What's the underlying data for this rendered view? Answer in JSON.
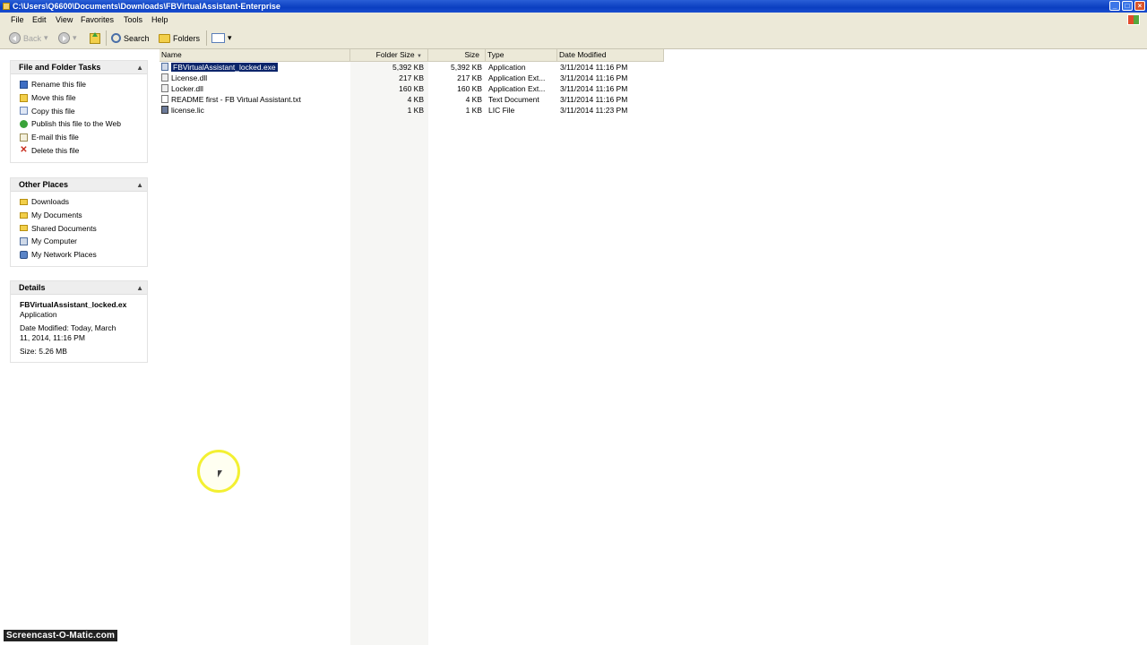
{
  "window": {
    "title": "C:\\Users\\Q6600\\Documents\\Downloads\\FBVirtualAssistant-Enterprise",
    "minimize": "_",
    "maximize": "□",
    "close": "×"
  },
  "menu": [
    "File",
    "Edit",
    "View",
    "Favorites",
    "Tools",
    "Help"
  ],
  "toolbar": {
    "back": "Back",
    "search": "Search",
    "folders": "Folders"
  },
  "tasks_panel": {
    "title": "File and Folder Tasks",
    "collapse": "▲",
    "items": [
      {
        "label": "Rename this file",
        "icon": "rename-icon"
      },
      {
        "label": "Move this file",
        "icon": "move-icon"
      },
      {
        "label": "Copy this file",
        "icon": "copy-icon"
      },
      {
        "label": "Publish this file to the Web",
        "icon": "web-icon"
      },
      {
        "label": "E-mail this file",
        "icon": "email-icon"
      },
      {
        "label": "Delete this file",
        "icon": "delete-icon"
      }
    ]
  },
  "places_panel": {
    "title": "Other Places",
    "collapse": "▲",
    "items": [
      {
        "label": "Downloads",
        "icon": "folder-icon"
      },
      {
        "label": "My Documents",
        "icon": "my-documents-icon"
      },
      {
        "label": "Shared Documents",
        "icon": "shared-documents-icon"
      },
      {
        "label": "My Computer",
        "icon": "computer-icon"
      },
      {
        "label": "My Network Places",
        "icon": "network-icon"
      }
    ]
  },
  "details_panel": {
    "title": "Details",
    "collapse": "▲",
    "name": "FBVirtualAssistant_locked.ex",
    "type": "Application",
    "modified_line1": "Date Modified: Today, March",
    "modified_line2": "11, 2014, 11:16 PM",
    "size": "Size: 5.26 MB"
  },
  "columns": {
    "name": "Name",
    "folder_size": "Folder Size",
    "size": "Size",
    "type": "Type",
    "date": "Date Modified"
  },
  "files": [
    {
      "name": "FBVirtualAssistant_locked.exe",
      "folder_size": "5,392 KB",
      "size": "5,392 KB",
      "type": "Application",
      "date": "3/11/2014 11:16 PM",
      "icon": "exe-icon"
    },
    {
      "name": "License.dll",
      "folder_size": "217 KB",
      "size": "217 KB",
      "type": "Application Ext...",
      "date": "3/11/2014 11:16 PM",
      "icon": "dll-icon"
    },
    {
      "name": "Locker.dll",
      "folder_size": "160 KB",
      "size": "160 KB",
      "type": "Application Ext...",
      "date": "3/11/2014 11:16 PM",
      "icon": "dll-icon"
    },
    {
      "name": "README first - FB Virtual Assistant.txt",
      "folder_size": "4 KB",
      "size": "4 KB",
      "type": "Text Document",
      "date": "3/11/2014 11:16 PM",
      "icon": "txt-icon"
    },
    {
      "name": "license.lic",
      "folder_size": "1 KB",
      "size": "1 KB",
      "type": "LIC File",
      "date": "3/11/2014 11:23 PM",
      "icon": "lic-icon"
    }
  ],
  "watermark": "Screencast-O-Matic.com"
}
